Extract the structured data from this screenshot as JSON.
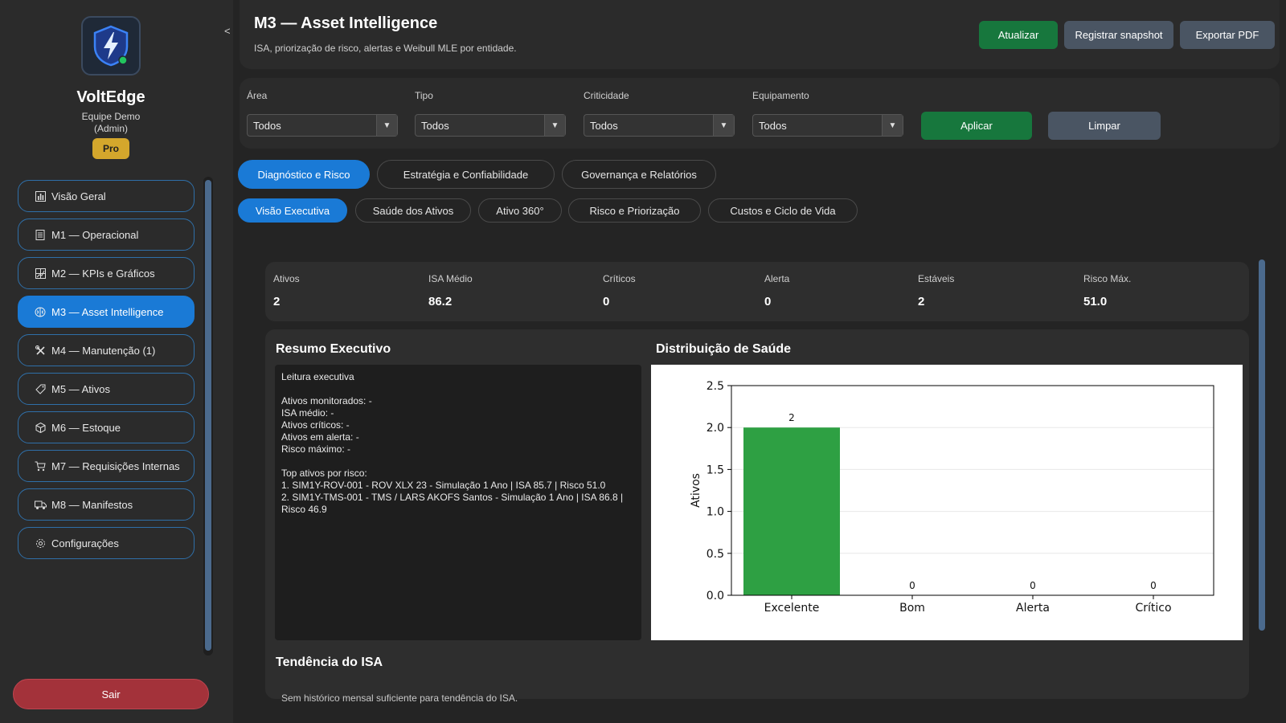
{
  "sidebar": {
    "brand_name": "VoltEdge",
    "team_line1": "Equipe Demo",
    "team_line2": "(Admin)",
    "plan": "Pro",
    "collapse_glyph": "<",
    "items": [
      {
        "label": "Visão Geral",
        "icon": "chart-icon"
      },
      {
        "label": "M1 — Operacional",
        "icon": "document-icon"
      },
      {
        "label": "M2 — KPIs e Gráficos",
        "icon": "grid-chart-icon"
      },
      {
        "label": "M3 — Asset Intelligence",
        "icon": "brain-icon",
        "active": true
      },
      {
        "label": "M4 — Manutenção (1)",
        "icon": "tools-icon"
      },
      {
        "label": "M5 — Ativos",
        "icon": "tag-icon"
      },
      {
        "label": "M6 — Estoque",
        "icon": "package-icon"
      },
      {
        "label": "M7 — Requisições Internas",
        "icon": "cart-icon"
      },
      {
        "label": "M8 — Manifestos",
        "icon": "truck-icon"
      },
      {
        "label": "Configurações",
        "icon": "gear-icon"
      }
    ],
    "logout": "Sair"
  },
  "header": {
    "title": "M3 — Asset Intelligence",
    "subtitle": "ISA, priorização de risco, alertas e Weibull MLE por entidade.",
    "btn_refresh": "Atualizar",
    "btn_snapshot": "Registrar snapshot",
    "btn_export": "Exportar PDF"
  },
  "filters": {
    "area_label": "Área",
    "area_value": "Todos",
    "tipo_label": "Tipo",
    "tipo_value": "Todos",
    "crit_label": "Criticidade",
    "crit_value": "Todos",
    "equip_label": "Equipamento",
    "equip_value": "Todos",
    "apply": "Aplicar",
    "clear": "Limpar"
  },
  "tabs": [
    "Diagnóstico e Risco",
    "Estratégia e Confiabilidade",
    "Governança e Relatórios"
  ],
  "subtabs": [
    "Visão Executiva",
    "Saúde dos Ativos",
    "Ativo 360°",
    "Risco e Priorização",
    "Custos e Ciclo de Vida"
  ],
  "kpis": [
    {
      "label": "Ativos",
      "value": "2"
    },
    {
      "label": "ISA Médio",
      "value": "86.2"
    },
    {
      "label": "Críticos",
      "value": "0"
    },
    {
      "label": "Alerta",
      "value": "0"
    },
    {
      "label": "Estáveis",
      "value": "2"
    },
    {
      "label": "Risco Máx.",
      "value": "51.0"
    }
  ],
  "summary": {
    "title": "Resumo Executivo",
    "lines": [
      "Leitura executiva",
      "",
      "Ativos monitorados: -",
      "ISA médio: -",
      "Ativos críticos: -",
      "Ativos em alerta: -",
      "Risco máximo: -",
      "",
      "Top ativos por risco:",
      "1. SIM1Y-ROV-001 - ROV XLX 23 - Simulação 1 Ano | ISA 85.7 | Risco 51.0",
      "2. SIM1Y-TMS-001 - TMS / LARS AKOFS Santos - Simulação 1 Ano | ISA 86.8 | Risco 46.9"
    ]
  },
  "distribution": {
    "title": "Distribuição de Saúde"
  },
  "chart_data": {
    "type": "bar",
    "categories": [
      "Excelente",
      "Bom",
      "Alerta",
      "Crítico"
    ],
    "values": [
      2,
      0,
      0,
      0
    ],
    "colors": [
      "#2ea043",
      "#2ea043",
      "#2ea043",
      "#2ea043"
    ],
    "title": "",
    "xlabel": "",
    "ylabel": "Ativos",
    "ylim": [
      0,
      2.5
    ],
    "yticks": [
      "0.0",
      "0.5",
      "1.0",
      "1.5",
      "2.0",
      "2.5"
    ],
    "grid": true
  },
  "trend": {
    "title": "Tendência do ISA",
    "message": "Sem histórico mensal suficiente para tendência do ISA."
  }
}
